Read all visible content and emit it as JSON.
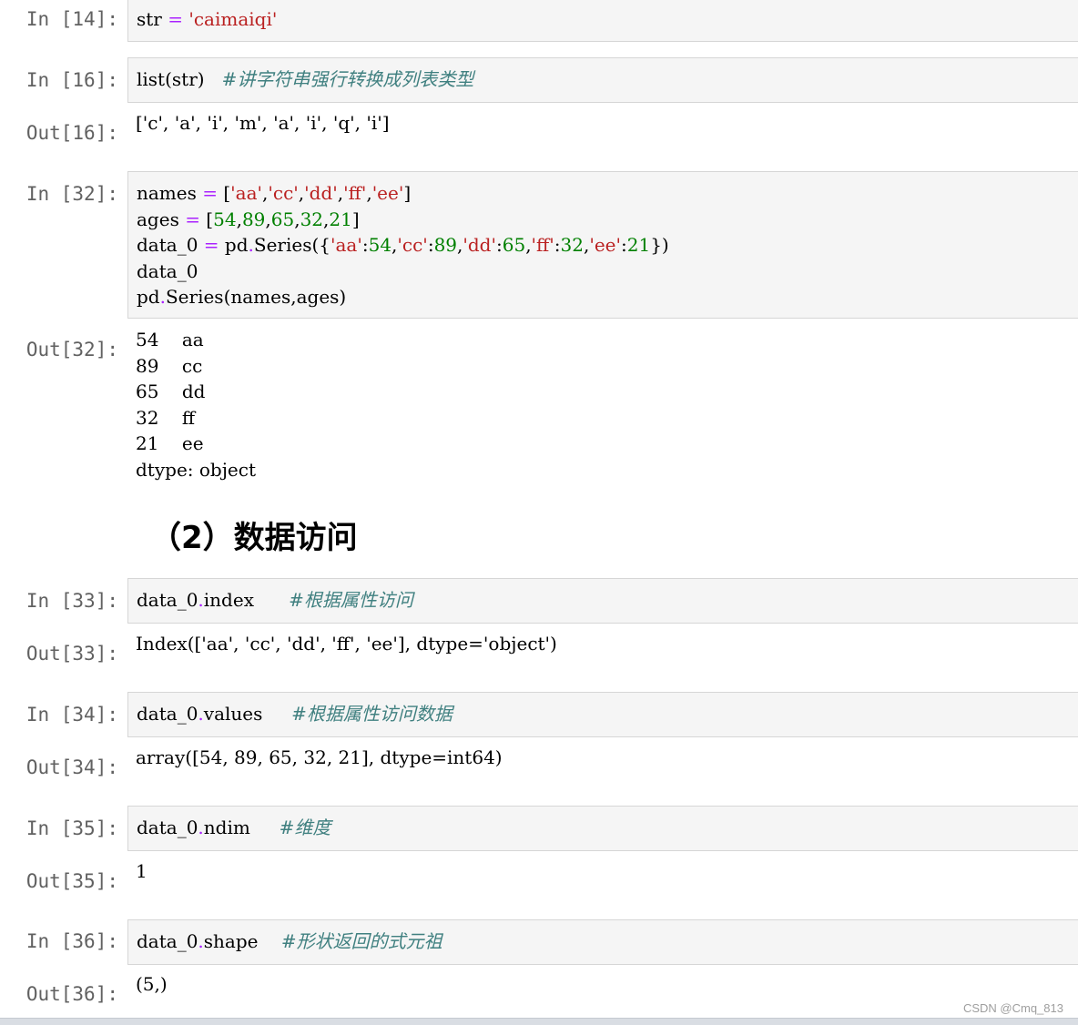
{
  "cells": [
    {
      "in_prompt": "In [14]:",
      "code_html": "str <span class='op'>=</span> <span class='str'>'caimaiqi'</span>",
      "out_prompt": "",
      "output": ""
    },
    {
      "in_prompt": "In [16]:",
      "code_html": "list(str)   <span class='cm'>#讲字符串强行转换成列表类型</span>",
      "out_prompt": "Out[16]:",
      "output": "['c', 'a', 'i', 'm', 'a', 'i', 'q', 'i']"
    },
    {
      "in_prompt": "In [32]:",
      "code_html": "names <span class='op'>=</span> [<span class='str'>'aa'</span>,<span class='str'>'cc'</span>,<span class='str'>'dd'</span>,<span class='str'>'ff'</span>,<span class='str'>'ee'</span>]\nages <span class='op'>=</span> [<span class='num'>54</span>,<span class='num'>89</span>,<span class='num'>65</span>,<span class='num'>32</span>,<span class='num'>21</span>]\ndata_0 <span class='op'>=</span> pd<span class='op'>.</span>Series({<span class='str'>'aa'</span>:<span class='num'>54</span>,<span class='str'>'cc'</span>:<span class='num'>89</span>,<span class='str'>'dd'</span>:<span class='num'>65</span>,<span class='str'>'ff'</span>:<span class='num'>32</span>,<span class='str'>'ee'</span>:<span class='num'>21</span>})\ndata_0\npd<span class='op'>.</span>Series(names,ages)",
      "out_prompt": "Out[32]:",
      "output": "54    aa\n89    cc\n65    dd\n32    ff\n21    ee\ndtype: object"
    },
    {
      "in_prompt": "In [33]:",
      "code_html": "data_0<span class='op'>.</span>index      <span class='cm'>#根据属性访问</span>",
      "out_prompt": "Out[33]:",
      "output": "Index(['aa', 'cc', 'dd', 'ff', 'ee'], dtype='object')"
    },
    {
      "in_prompt": "In [34]:",
      "code_html": "data_0<span class='op'>.</span>values     <span class='cm'>#根据属性访问数据</span>",
      "out_prompt": "Out[34]:",
      "output": "array([54, 89, 65, 32, 21], dtype=int64)"
    },
    {
      "in_prompt": "In [35]:",
      "code_html": "data_0<span class='op'>.</span>ndim     <span class='cm'>#维度</span>",
      "out_prompt": "Out[35]:",
      "output": "1"
    },
    {
      "in_prompt": "In [36]:",
      "code_html": "data_0<span class='op'>.</span>shape    <span class='cm'>#形状返回的式元祖</span>",
      "out_prompt": "Out[36]:",
      "output": "(5,)"
    }
  ],
  "heading": "（2）数据访问",
  "watermark": "CSDN @Cmq_813"
}
